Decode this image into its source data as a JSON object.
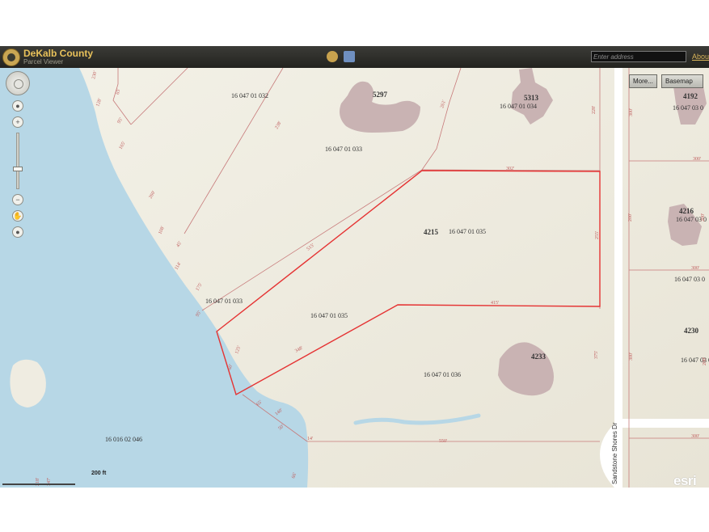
{
  "app": {
    "title": "DeKalb County",
    "subtitle": "Parcel Viewer",
    "search": {
      "placeholder": "Enter address"
    },
    "about_label": "About",
    "buttons": {
      "more": "More...",
      "basemap": "Basemap"
    }
  },
  "nav_icons": [
    "pan-compass-icon",
    "full-extent-icon",
    "zoom-in-icon",
    "zoom-out-icon",
    "hand-icon",
    "globe-icon"
  ],
  "scale": {
    "label": "200 ft"
  },
  "attribution": "esri",
  "colors": {
    "water": "#b7d7e6",
    "land": "#efece1",
    "building": "#c9b3b3",
    "parcel_line": "#c77a7a",
    "selected_parcel": "#e53333",
    "road": "#ffffff",
    "topbar": "#2c2c28",
    "title": "#e8c15a"
  },
  "parcel_ids": {
    "p1": "16 047 01 032",
    "p2": "16 047 01 033",
    "p3": "16 047 01 035",
    "p4": "16 047 01 033",
    "p5": "16 047 01 035",
    "p6": "16 047 01 036",
    "p7": "16 047 01 034",
    "p8": "16 016 02 046",
    "p9": "16 047 03 0",
    "p10": "16 047 03 0",
    "p11": "16 047 03 0",
    "p12": "16 047 03 0"
  },
  "addresses": {
    "a5297": "5297",
    "a5313": "5313",
    "a4215": "4215",
    "a4233": "4233",
    "a4192": "4192",
    "a4216": "4216",
    "a4230": "4230"
  },
  "road_name": "Sandstone Shores Dr",
  "dimensions": {
    "d1": "230'",
    "d2": "128'",
    "d3": "95'",
    "d4": "165'",
    "d5": "65'",
    "d6": "238'",
    "d7": "261'",
    "d8": "228'",
    "d9": "260'",
    "d10": "108'",
    "d11": "45'",
    "d12": "114'",
    "d13": "175'",
    "d14": "515'",
    "d15": "302'",
    "d16": "255'",
    "d17": "415'",
    "d18": "348'",
    "d19": "125'",
    "d20": "60'",
    "d21": "65'",
    "d22": "140'",
    "d23": "50'",
    "d24": "14'",
    "d25": "550'",
    "d26": "375'",
    "d27": "300'",
    "d28": "300'",
    "d29": "300'",
    "d30": "300'",
    "d31": "300'",
    "d32": "200'",
    "d33": "200'",
    "d34": "200'",
    "d35": "218'",
    "d36": "347'",
    "d37": "95'",
    "d38": "66'"
  }
}
